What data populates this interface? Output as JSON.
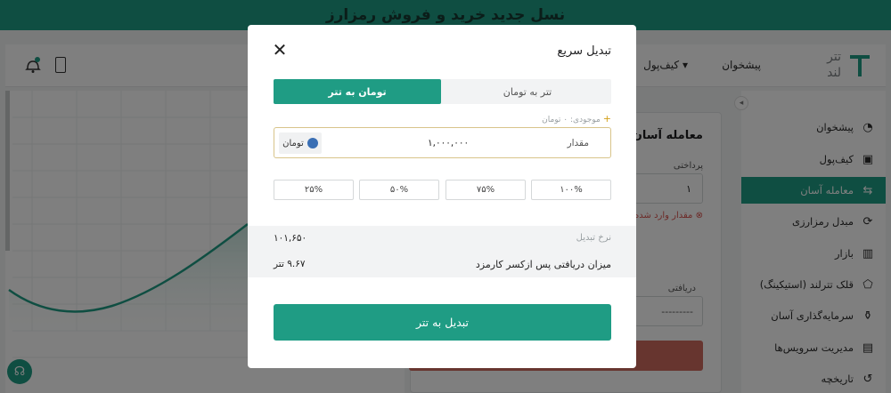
{
  "banner": {
    "text": "نسل جدید خرید و فروش رمزارز"
  },
  "header": {
    "logo_line1": "تتر",
    "logo_line2": "لند",
    "nav_dashboard": "پیشخوان",
    "nav_wallet": "کیف‌پول"
  },
  "sidebar": {
    "items": [
      {
        "label": "پیشخوان",
        "icon": "dashboard-icon"
      },
      {
        "label": "کیف‌پول",
        "icon": "wallet-icon"
      },
      {
        "label": "معامله آسان",
        "icon": "exchange-icon",
        "active": true
      },
      {
        "label": "مبدل رمزارزی",
        "icon": "converter-icon"
      },
      {
        "label": "بازار",
        "icon": "market-chart-icon"
      },
      {
        "label": "قلک تترلند (استیکینگ)",
        "icon": "piggy-bank-icon"
      },
      {
        "label": "سرمایه‌گذاری آسان",
        "icon": "investment-icon"
      },
      {
        "label": "مدیریت سرویس‌ها",
        "icon": "briefcase-icon"
      },
      {
        "label": "تاریخچه",
        "icon": "history-icon"
      }
    ]
  },
  "trade": {
    "title": "معامله آسان",
    "pay_label": "پرداختی",
    "pay_value": "۱",
    "error": "مقدار وارد شده",
    "receive_label": "دریافتی",
    "receive_value": "---------"
  },
  "modal": {
    "title": "تبدیل سریع",
    "tab_toman_to_tether": "تومان به تتر",
    "tab_tether_to_toman": "تتر به تومان",
    "balance": "موجودی: ۰ تومان",
    "amount_label": "مقدار",
    "amount_value": "۱,۰۰۰,۰۰۰",
    "unit": "تومان",
    "percents": [
      "۲۵%",
      "۵۰%",
      "۷۵%",
      "۱۰۰%"
    ],
    "rate_label": "نرخ تبدیل",
    "rate_value": "۱۰۱,۶۵۰",
    "receive_label": "میزان دریافتی پس ازکسر کارمزد",
    "receive_value": "۹.۶۷ تتر",
    "convert_button": "تبدیل به تتر"
  },
  "chart_data": {
    "type": "area",
    "x": [
      "",
      "",
      "",
      "",
      "",
      "",
      "",
      "",
      ""
    ],
    "title": "",
    "xlabel": "",
    "ylabel": "",
    "colors": {
      "line": "#1f9c84",
      "fill": "#bfe3da"
    }
  },
  "colors": {
    "brand": "#1f9c84",
    "danger": "#cf6a5f"
  }
}
